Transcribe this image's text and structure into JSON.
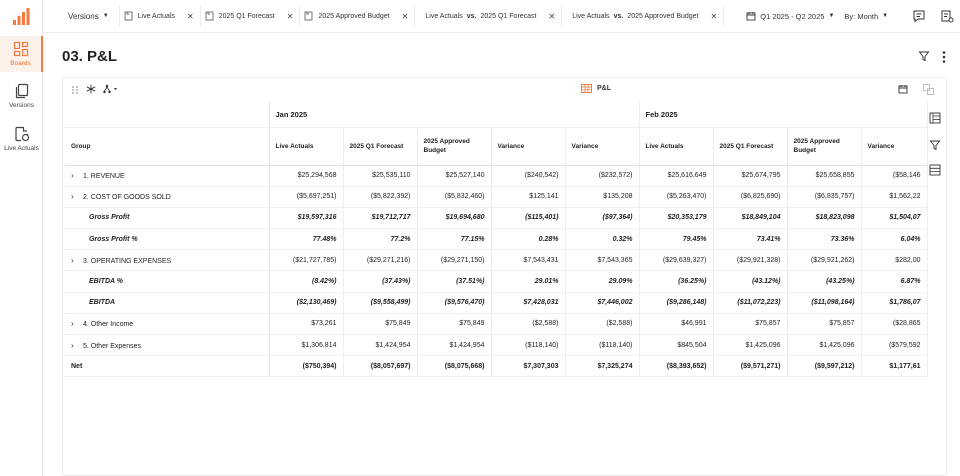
{
  "nav": {
    "items": [
      {
        "label": "Boards",
        "active": true
      },
      {
        "label": "Versions",
        "active": false
      },
      {
        "label": "Live Actuals",
        "active": false
      }
    ]
  },
  "topbar": {
    "versions_label": "Versions",
    "chips": [
      {
        "label": "Live Actuals"
      },
      {
        "label": "2025 Q1 Forecast"
      },
      {
        "label": "2025 Approved Budget"
      }
    ],
    "comparisons": [
      {
        "left": "Live Actuals",
        "vs": "vs.",
        "right": "2025 Q1 Forecast"
      },
      {
        "left": "Live Actuals",
        "vs": "vs.",
        "right": "2025 Approved Budget"
      }
    ],
    "period": "Q1 2025 - Q2 2025",
    "granularity": "By: Month"
  },
  "page": {
    "title": "03. P&L"
  },
  "panel": {
    "title": "P&L"
  },
  "table": {
    "group_header": "Group",
    "months": [
      "Jan 2025",
      "Feb 2025"
    ],
    "columns": [
      "Live Actuals",
      "2025 Q1 Forecast",
      "2025 Approved Budget",
      "Variance",
      "Variance",
      "Live Actuals",
      "2025 Q1 Forecast",
      "2025 Approved Budget",
      "Variance"
    ],
    "rows": [
      {
        "label": "1. REVENUE",
        "type": "group",
        "values": [
          "$25,294,568",
          "$25,535,110",
          "$25,527,140",
          "($240,542)",
          "($232,572)",
          "$25,616,649",
          "$25,674,795",
          "$25,658,855",
          "($58,146"
        ]
      },
      {
        "label": "2. COST OF GOODS SOLD",
        "type": "group",
        "values": [
          "($5,697,251)",
          "($5,822,392)",
          "($5,832,460)",
          "$125,141",
          "$135,208",
          "($5,263,470)",
          "($6,825,690)",
          "($6,835,757)",
          "$1,562,22"
        ]
      },
      {
        "label": "Gross Profit",
        "type": "sub",
        "values": [
          "$19,597,316",
          "$19,712,717",
          "$19,694,680",
          "($115,401)",
          "($97,364)",
          "$20,353,179",
          "$18,849,104",
          "$18,823,098",
          "$1,504,07"
        ]
      },
      {
        "label": "Gross Profit %",
        "type": "sub",
        "values": [
          "77.48%",
          "77.2%",
          "77.15%",
          "0.28%",
          "0.32%",
          "79.45%",
          "73.41%",
          "73.36%",
          "6.04%"
        ]
      },
      {
        "label": "3. OPERATING EXPENSES",
        "type": "group",
        "values": [
          "($21,727,785)",
          "($29,271,216)",
          "($29,271,150)",
          "$7,543,431",
          "$7,543,365",
          "($29,639,327)",
          "($29,921,328)",
          "($29,921,262)",
          "$282,00"
        ]
      },
      {
        "label": "EBITDA %",
        "type": "sub",
        "values": [
          "(8.42%)",
          "(37.43%)",
          "(37.51%)",
          "29.01%",
          "29.09%",
          "(36.25%)",
          "(43.12%)",
          "(43.25%)",
          "6.87%"
        ]
      },
      {
        "label": "EBITDA",
        "type": "sub",
        "values": [
          "($2,130,469)",
          "($9,558,499)",
          "($9,576,470)",
          "$7,428,031",
          "$7,446,002",
          "($9,286,148)",
          "($11,072,223)",
          "($11,098,164)",
          "$1,786,07"
        ]
      },
      {
        "label": "4. Other Income",
        "type": "group",
        "values": [
          "$73,261",
          "$75,849",
          "$75,849",
          "($2,588)",
          "($2,588)",
          "$46,991",
          "$75,857",
          "$75,857",
          "($28,865"
        ]
      },
      {
        "label": "5. Other Expenses",
        "type": "group",
        "values": [
          "$1,306,814",
          "$1,424,954",
          "$1,424,954",
          "($118,140)",
          "($118,140)",
          "$845,504",
          "$1,425,096",
          "$1,425,096",
          "($579,592"
        ]
      },
      {
        "label": "Net",
        "type": "net",
        "values": [
          "($750,394)",
          "($8,057,697)",
          "($8,075,668)",
          "$7,307,303",
          "$7,325,274",
          "($8,393,652)",
          "($9,571,271)",
          "($9,597,212)",
          "$1,177,61"
        ]
      }
    ]
  },
  "colors": {
    "accent": "#f47a3e",
    "border": "#ececec"
  }
}
